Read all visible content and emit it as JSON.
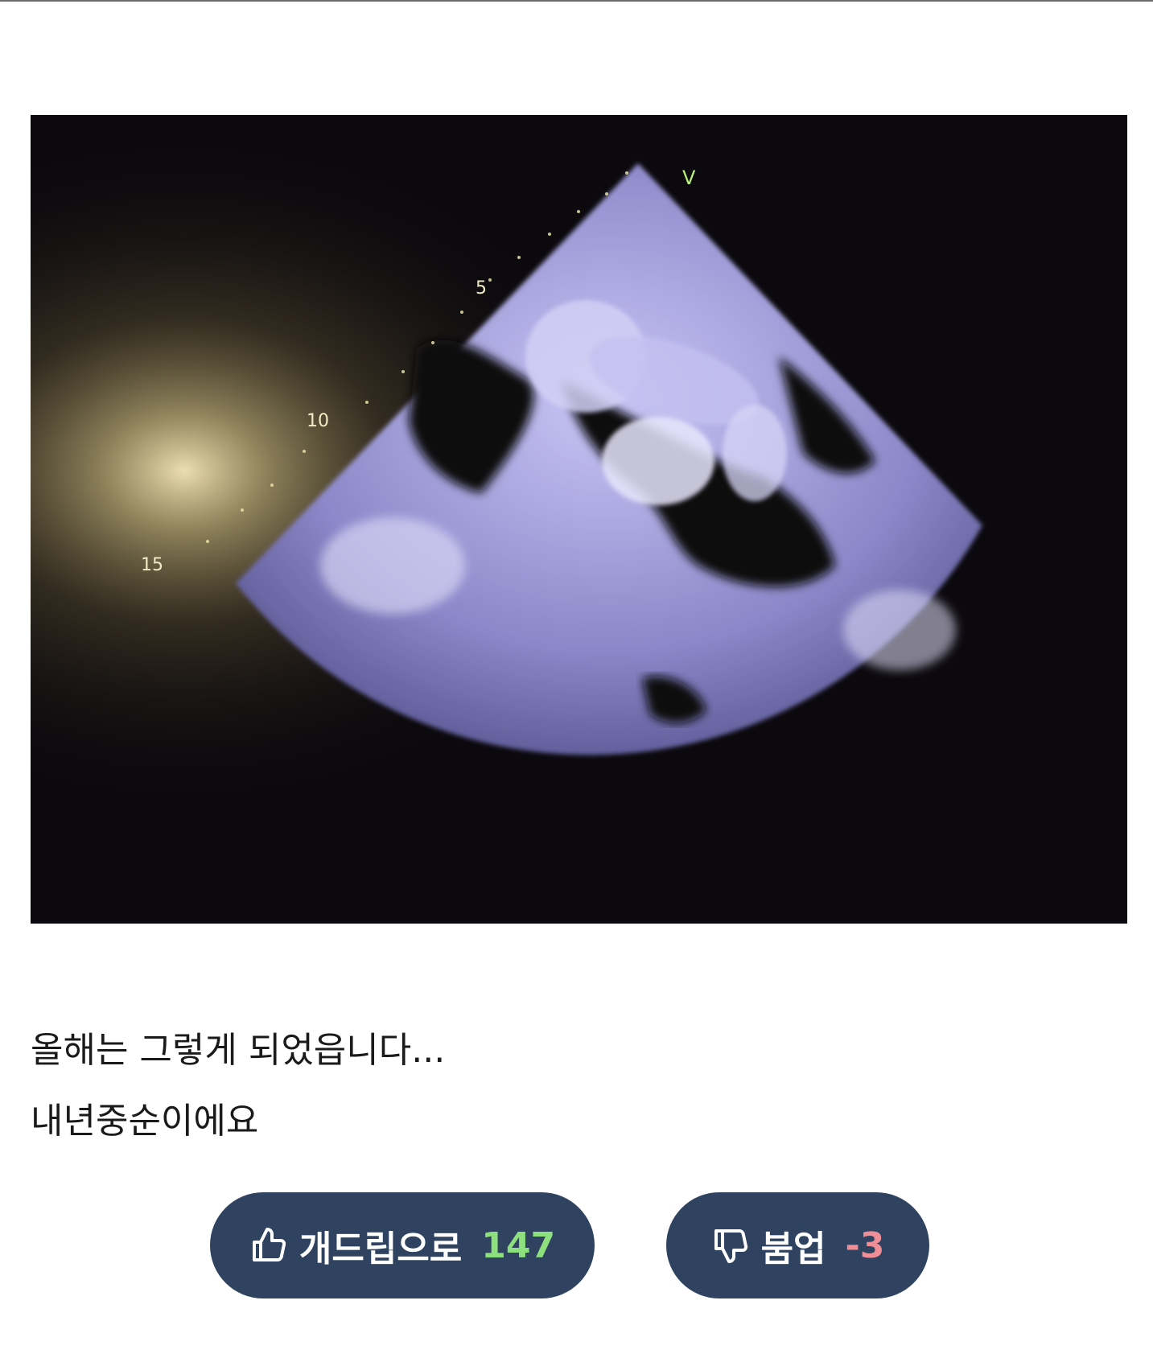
{
  "post": {
    "image": {
      "ruler_labels": [
        "5",
        "10",
        "15"
      ],
      "marker_label": "V"
    },
    "text_lines": [
      "올해는 그렇게 되었읍니다...",
      "내년중순이에요"
    ]
  },
  "votes": {
    "upvote": {
      "icon": "thumbs-up-icon",
      "label": "개드립으로",
      "count": "147",
      "count_color": "#8ee07f"
    },
    "downvote": {
      "icon": "thumbs-down-icon",
      "label": "붐업",
      "count": "-3",
      "count_color": "#f08e97"
    }
  },
  "colors": {
    "button_bg": "#2f4260",
    "ultrasound_tint": "#b7b4ee",
    "marker_green": "#b8f07a"
  }
}
